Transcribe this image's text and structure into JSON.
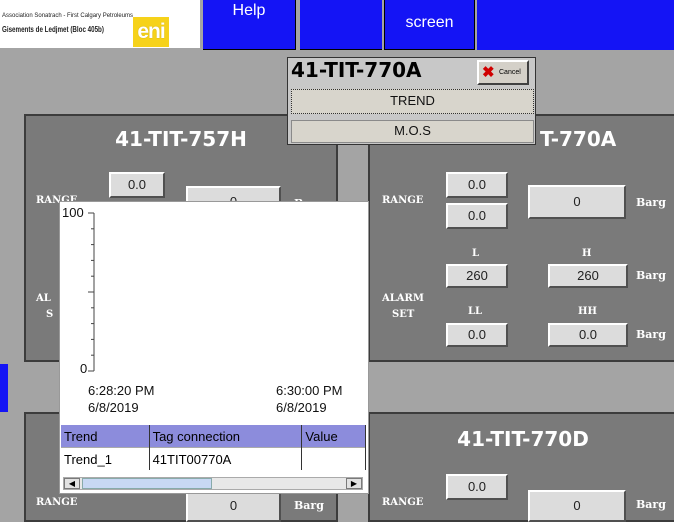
{
  "header": {
    "company_line1": "Association Sonatrach - First Calgary Petroleums",
    "company_line2": "Gisements de Ledjmet (Bloc 405b)",
    "logo_text": "eni",
    "buttons": {
      "help": "Help",
      "screen": "screen"
    }
  },
  "popup": {
    "tag": "41-TIT-770A",
    "cancel_label": "Cancel",
    "items": [
      "TREND",
      "M.O.S"
    ]
  },
  "panels": [
    {
      "title": "41-TIT-757H",
      "range_label": "RANGE",
      "range_low": "0.0",
      "value": "0",
      "unit": "Barg",
      "alarm_label_partial": "AL",
      "set_label_partial": "S"
    },
    {
      "title_partial": "T-770A",
      "range_label": "RANGE",
      "range_low": "0.0",
      "range_high": "0.0",
      "value": "0",
      "unit": "Barg",
      "l_label": "L",
      "h_label": "H",
      "l_value": "260",
      "h_value": "260",
      "alarm_label": "ALARM",
      "set_label": "SET",
      "ll_label": "LL",
      "hh_label": "HH",
      "ll_value": "0.0",
      "hh_value": "0.0"
    },
    {
      "title": "",
      "range_label": "RANGE",
      "value": "0",
      "unit": "Barg"
    },
    {
      "title": "41-TIT-770D",
      "range_label": "RANGE",
      "range_low": "0.0",
      "value": "0",
      "unit": "Barg"
    }
  ],
  "trend": {
    "y_max": "100",
    "y_min": "0",
    "start_time": "6:28:20 PM",
    "start_date": "6/8/2019",
    "end_time": "6:30:00 PM",
    "end_date": "6/8/2019",
    "table": {
      "headers": [
        "Trend",
        "Tag connection",
        "Value"
      ],
      "rows": [
        [
          "Trend_1",
          "41TIT00770A",
          ""
        ]
      ]
    }
  },
  "colors": {
    "blue": "#1414f5",
    "panel_gray": "#7a7a7a",
    "bg_gray": "#a4a4a4",
    "table_header": "#8c8cdc"
  }
}
